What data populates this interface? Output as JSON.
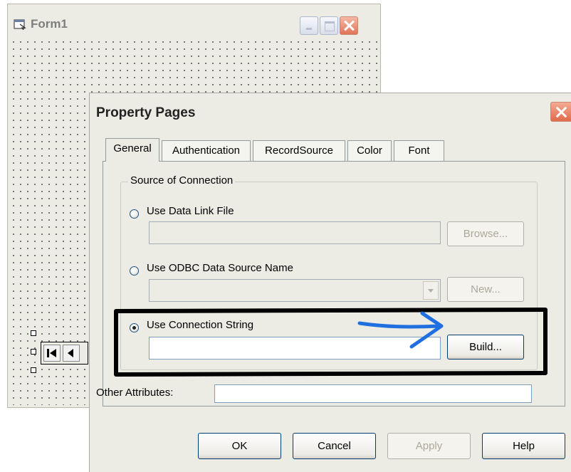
{
  "form1": {
    "title": "Form1",
    "icon": "form-icon",
    "title_buttons": [
      "minimize-icon",
      "maximize-icon",
      "close-icon"
    ],
    "navigator_icons": [
      "first-record-icon",
      "previous-record-icon"
    ]
  },
  "dialog": {
    "title": "Property Pages",
    "close_icon": "close-icon",
    "tabs": [
      {
        "label": "General",
        "active": true
      },
      {
        "label": "Authentication",
        "active": false
      },
      {
        "label": "RecordSource",
        "active": false
      },
      {
        "label": "Color",
        "active": false
      },
      {
        "label": "Font",
        "active": false
      }
    ],
    "group": {
      "label": "Source of Connection",
      "options": [
        {
          "label": "Use Data Link File",
          "checked": false,
          "button": "Browse...",
          "button_enabled": false
        },
        {
          "label": "Use ODBC Data Source Name",
          "checked": false,
          "button": "New...",
          "button_enabled": false
        },
        {
          "label": "Use Connection String",
          "checked": true,
          "button": "Build...",
          "button_enabled": true
        }
      ]
    },
    "other_attributes_label": "Other Attributes:",
    "buttons": {
      "ok": "OK",
      "cancel": "Cancel",
      "apply": "Apply",
      "help": "Help"
    }
  },
  "annotation": {
    "arrow_color": "#1f6fe0",
    "box_color": "#000000"
  }
}
